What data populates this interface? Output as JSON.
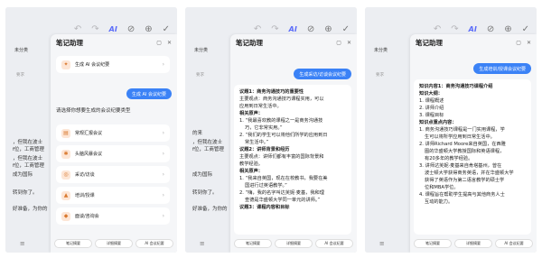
{
  "toolbar": {
    "undo": "↶",
    "redo": "↷",
    "ai_label": "AI",
    "check": "⊘",
    "add": "⊕",
    "done": "✓"
  },
  "note": {
    "category": "未分类",
    "list_label": "要求",
    "bg_lines_p1": [
      "，但我在波士",
      "f位，工商管理",
      "，但我在波士",
      "f位，工商管理",
      "成为国际",
      "转到你了。",
      "好准备，为你的"
    ],
    "bg_lines_p2": [
      "的来",
      "，但我在波士",
      "f位，工商管理",
      "成为国际",
      "转到你了。",
      "好准备，为你的"
    ]
  },
  "panel": {
    "title": "笔记助理",
    "chips": [
      "笔记摘要",
      "详细摘要",
      "AI 会议纪要"
    ]
  },
  "phone1": {
    "top_item": "生成 AI 会议纪要",
    "bubble": "生成 AI 会议纪要",
    "prompt": "请选择你想要生成的会议纪要类型",
    "types": [
      "常规汇报会议",
      "头脑风暴会议",
      "采访/访谈",
      "培训/授课",
      "面谈/咨询会"
    ]
  },
  "phone2": {
    "bubble": "生成采访/访谈会议纪要",
    "lines": [
      {
        "t": "议题1：商务沟通技巧的重要性",
        "b": true
      },
      {
        "t": "主要观点：商务沟通技巧课程实用，可以",
        "b": false
      },
      {
        "t": "应用到日常生活中。",
        "b": false
      },
      {
        "t": "相关原声：",
        "b": true
      },
      {
        "t": "1. “我最喜欢教的课程之一是商务沟通技",
        "b": false
      },
      {
        "t": "巧，它非常实用。”",
        "b": false,
        "i": true
      },
      {
        "t": "2. “我们的学生可以将他们所学的应用到日",
        "b": false
      },
      {
        "t": "常生活中。”",
        "b": false,
        "i": true
      },
      {
        "t": "议题2：讲师背景和经历",
        "b": true
      },
      {
        "t": "主要观点：讲师们都有丰富的国际背景和",
        "b": false
      },
      {
        "t": "教学经验。",
        "b": false
      },
      {
        "t": "相关原声：",
        "b": true
      },
      {
        "t": "1. “我来自英国，现在在校教书，我要在美",
        "b": false
      },
      {
        "t": "国进行过英语教学。”",
        "b": false,
        "i": true
      },
      {
        "t": "2. “嗨，我的名字叫达芙妮·麦基，我和理",
        "b": false
      },
      {
        "t": "查德是华盛顿大学同一单元的讲师。”",
        "b": false,
        "i": true
      },
      {
        "t": "议题3：课程内容和目标",
        "b": true
      }
    ]
  },
  "phone3": {
    "bubble": "生成培训/授课会议纪要",
    "lines": [
      {
        "t": "知识内容1：商务沟通技巧课程介绍",
        "b": true
      },
      {
        "t": "知识大纲：",
        "b": true
      },
      {
        "t": "1. 课程概述",
        "b": false
      },
      {
        "t": "2. 讲师介绍",
        "b": false
      },
      {
        "t": "3. 课程目标",
        "b": false
      },
      {
        "t": "知识点重点内容：",
        "b": true
      },
      {
        "t": "1. 商务沟通技巧课程是一门实用课程，学",
        "b": false
      },
      {
        "t": "生可以将所学应用到日常生活中。",
        "b": false,
        "i": true
      },
      {
        "t": "2. 讲师Richard Moore来自英国，在西雅",
        "b": false
      },
      {
        "t": "图的华盛顿大学教授国际和英语课程，",
        "b": false,
        "i": true
      },
      {
        "t": "有20多年的教学经验。",
        "b": false,
        "i": true
      },
      {
        "t": "3. 讲师达芙妮·麦基来自肯塔基州，曾在",
        "b": false
      },
      {
        "t": "波士顿大学获得商务英语，并在华盛顿大学",
        "b": false,
        "i": true
      },
      {
        "t": "获得了英语作为第二语言教学的硕士学",
        "b": false,
        "i": true
      },
      {
        "t": "位和MBA学位。",
        "b": false,
        "i": true
      },
      {
        "t": "4. 课程旨在帮助学生提高与其他商务人士",
        "b": false
      },
      {
        "t": "互动的能力。",
        "b": false,
        "i": true
      }
    ]
  }
}
